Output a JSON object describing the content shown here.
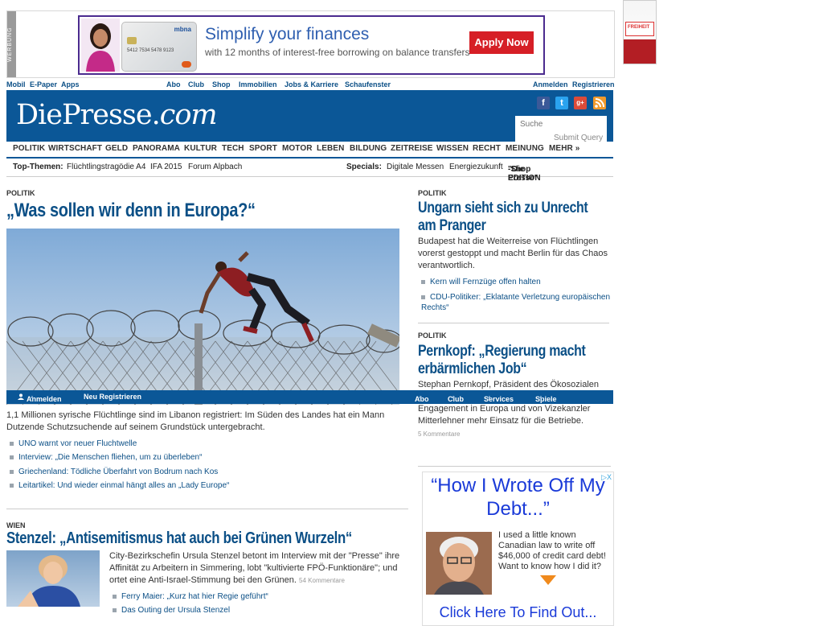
{
  "top_ad": {
    "werbung": "WERBUNG",
    "headline": "Simplify your finances",
    "sub": "with 12 months of interest-free borrowing on balance transfers*",
    "cta": "Apply Now",
    "card_brand": "mbna",
    "card_number": "5412 7534 5478 9123",
    "close": "▷X"
  },
  "side_ad": {
    "label": "FREIHEIT"
  },
  "utility_nav": {
    "left": [
      "Mobil",
      "E-Paper",
      "Apps"
    ],
    "center": [
      "Abo",
      "Club",
      "Shop",
      "Immobilien",
      "Jobs & Karriere",
      "Schaufenster"
    ],
    "right": [
      "Anmelden",
      "Registrieren"
    ]
  },
  "header": {
    "logo_main": "DiePresse.",
    "logo_suffix": "com",
    "social": [
      "f",
      "t",
      "g+",
      "rss"
    ],
    "search_placeholder": "Suche",
    "search_submit": "Submit Query"
  },
  "main_nav": [
    "POLITIK",
    "WIRTSCHAFT",
    "GELD",
    "PANORAMA",
    "KULTUR",
    "TECH",
    "SPORT",
    "MOTOR",
    "LEBEN",
    "BILDUNG",
    "ZEITREISE",
    "WISSEN",
    "RECHT",
    "MEINUNG",
    "MEHR »"
  ],
  "topics": {
    "label": "Top-Themen:",
    "items": [
      "Flüchtlingstragödie A4",
      "IFA 2015",
      "Forum Alpbach"
    ],
    "specials_label": "Specials:",
    "specials": [
      "Digitale Messen",
      "Energiezukunft"
    ],
    "shop_quote": "\"Die Presse\"",
    "shop_rest": "-Shop EDITION"
  },
  "lead": {
    "kicker": "POLITIK",
    "headline": "„Was sollen wir denn in Europa?“",
    "text": "1,1 Millionen syrische Flüchtlinge sind im Libanon registriert: Im Süden des Landes hat ein Mann Dutzende Schutzsuchende auf seinem Grundstück untergebracht.",
    "links": [
      "UNO warnt vor neuer Fluchtwelle",
      "Interview: „Die Menschen fliehen, um zu überleben“",
      "Griechenland: Tödliche Überfahrt von Bodrum nach Kos",
      "Leitartikel: Und wieder einmal hängt alles an „Lady Europe“"
    ]
  },
  "stenzel": {
    "kicker": "WIEN",
    "headline": "Stenzel: „Antisemitismus hat auch bei Grünen Wurzeln“",
    "text": "City-Bezirkschefin Ursula Stenzel betont im Interview mit der \"Presse\" ihre Affinität zu Arbeitern in Simmering, lobt \"kultivierte FPÖ-Funktionäre\"; und ortet eine Anti-Israel-Stimmung bei den Grünen.",
    "comments": "54 Kommentare",
    "links": [
      "Ferry Maier: „Kurz hat hier Regie geführt“",
      "Das Outing der Ursula Stenzel"
    ]
  },
  "ungarn": {
    "kicker": "POLITIK",
    "headline_line1": "Ungarn sieht sich zu Unrecht",
    "headline_line2": "am Pranger",
    "text": "Budapest hat die Weiterreise von Flüchtlingen vorerst gestoppt und macht Berlin für das Chaos verantwortlich.",
    "links": [
      "Kern will Fernzüge offen halten",
      "CDU-Politiker: „Eklatante Verletzung europäischen Rechts“"
    ]
  },
  "pernkopf": {
    "kicker": "POLITIK",
    "headline_line1": "Pernkopf: „Regierung macht",
    "headline_line2": "erbärmlichen Job“",
    "text_line1": "Stephan Pernkopf, Präsident des Ökosozialen",
    "text_rest": "Engagement in Europa und von Vizekanzler Mitterlehner mehr Einsatz für die Betriebe.",
    "comments": "5 Kommentare"
  },
  "loginbar": {
    "login": "Anmelden",
    "register": "Neu Registrieren",
    "abo": "Abo",
    "club": "Club",
    "services": "Services",
    "games": "Spiele & Rätsel"
  },
  "right_ad": {
    "headline": "“How I Wrote Off My Debt...”",
    "text": "I used a little known Canadian law to write off $46,000 of credit card debt! Want to know how I did it?",
    "cta": "Click Here To Find Out...",
    "close": "▷X"
  },
  "colors": {
    "brand_blue": "#0b5797",
    "link_blue": "#0b4f86",
    "ad_red": "#d61f26"
  }
}
